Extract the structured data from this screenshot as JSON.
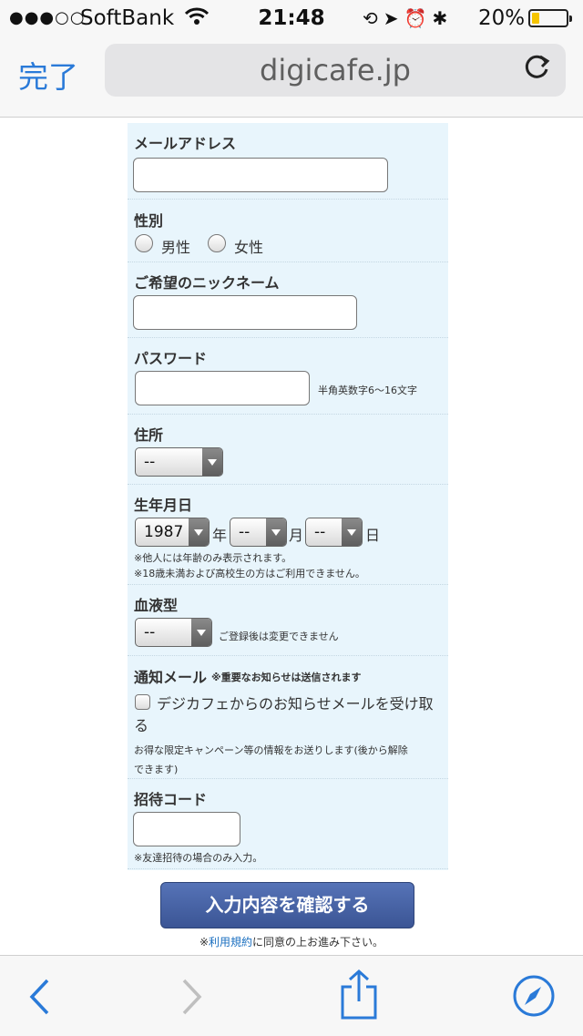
{
  "status": {
    "carrier": "SoftBank",
    "signal": "●●●○○",
    "time": "21:48",
    "battery": "20%",
    "battery_color": "#f5c400"
  },
  "nav": {
    "done": "完了",
    "url": "digicafe.jp",
    "accent": "#2a7ad8"
  },
  "form": {
    "email": {
      "label": "メールアドレス",
      "value": ""
    },
    "gender": {
      "label": "性別",
      "options": [
        "男性",
        "女性"
      ]
    },
    "nickname": {
      "label": "ご希望のニックネーム",
      "value": ""
    },
    "password": {
      "label": "パスワード",
      "value": "",
      "hint": "半角英数字6〜16文字"
    },
    "address": {
      "label": "住所",
      "selected": "--"
    },
    "birthday": {
      "label": "生年月日",
      "year": "1987",
      "year_unit": "年",
      "month": "--",
      "month_unit": "月",
      "day": "--",
      "day_unit": "日",
      "note1": "※他人には年齢のみ表示されます。",
      "note2": "※18歳未満および高校生の方はご利用できません。"
    },
    "blood": {
      "label": "血液型",
      "selected": "--",
      "hint": "ご登録後は変更できません"
    },
    "notice": {
      "label": "通知メール",
      "label_note": "※重要なお知らせは送信されます",
      "checkbox_line1": "デジカフェからのお知らせメールを受け取",
      "checkbox_line2": "る",
      "desc_line1": "お得な限定キャンペーン等の情報をお送りします(後から解除",
      "desc_line2": "できます)"
    },
    "invite": {
      "label": "招待コード",
      "value": "",
      "note": "※友達招待の場合のみ入力。"
    },
    "submit": "入力内容を確認する",
    "agree_prefix": "※",
    "agree_link": "利用規約",
    "agree_suffix": "に同意の上お進み下さい。"
  }
}
